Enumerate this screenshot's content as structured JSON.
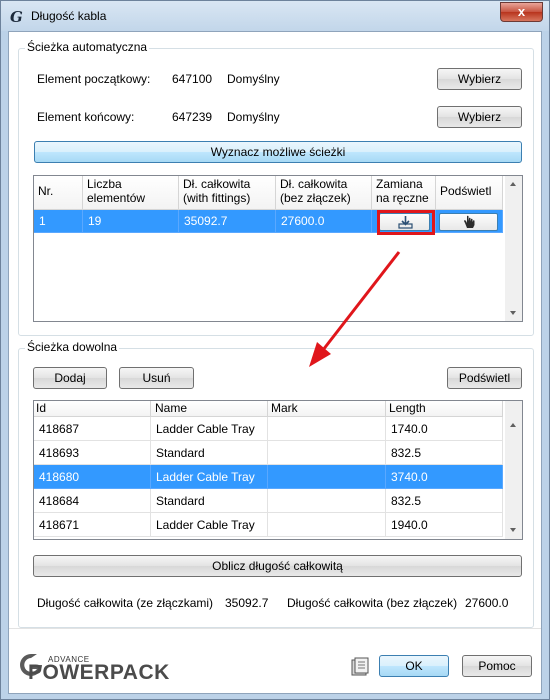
{
  "window": {
    "title": "Długość kabla",
    "close_label": "x"
  },
  "auto_path": {
    "group_label": "Ścieżka automatyczna",
    "start_label": "Element początkowy:",
    "start_id": "647100",
    "start_mode": "Domyślny",
    "end_label": "Element końcowy:",
    "end_id": "647239",
    "end_mode": "Domyślny",
    "select_label": "Wybierz",
    "compute_paths_label": "Wyznacz możliwe ścieżki",
    "columns": [
      "Nr.",
      "Liczba elementów",
      "Dł. całkowita (with fittings)",
      "Dł. całkowita (bez złączek)",
      "Zamiana na ręczne",
      "Podświetl"
    ],
    "rows": [
      {
        "nr": "1",
        "count": "19",
        "total_with": "35092.7",
        "total_without": "27600.0"
      }
    ]
  },
  "custom_path": {
    "group_label": "Ścieżka dowolna",
    "add_label": "Dodaj",
    "remove_label": "Usuń",
    "highlight_label": "Podświetl",
    "columns": [
      "Id",
      "Name",
      "Mark",
      "Length"
    ],
    "rows": [
      {
        "id": "418687",
        "name": "Ladder Cable Tray",
        "mark": "",
        "length": "1740.0"
      },
      {
        "id": "418693",
        "name": "Standard",
        "mark": "",
        "length": "832.5"
      },
      {
        "id": "418680",
        "name": "Ladder Cable Tray",
        "mark": "",
        "length": "3740.0"
      },
      {
        "id": "418684",
        "name": "Standard",
        "mark": "",
        "length": "832.5"
      },
      {
        "id": "418671",
        "name": "Ladder Cable Tray",
        "mark": "",
        "length": "1940.0"
      }
    ],
    "selected_row": 2,
    "calculate_label": "Oblicz długość całkowitą"
  },
  "totals": {
    "with_label": "Długość całkowita (ze złączkami)",
    "with_value": "35092.7",
    "without_label": "Długość całkowita (bez złączek)",
    "without_value": "27600.0"
  },
  "footer": {
    "logo_small": "ADVANCE",
    "logo_big": "POWERPACK",
    "ok_label": "OK",
    "help_label": "Pomoc"
  },
  "colors": {
    "selection": "#3399ff",
    "highlight_box": "#e0161b",
    "arrow": "#e0161b"
  }
}
